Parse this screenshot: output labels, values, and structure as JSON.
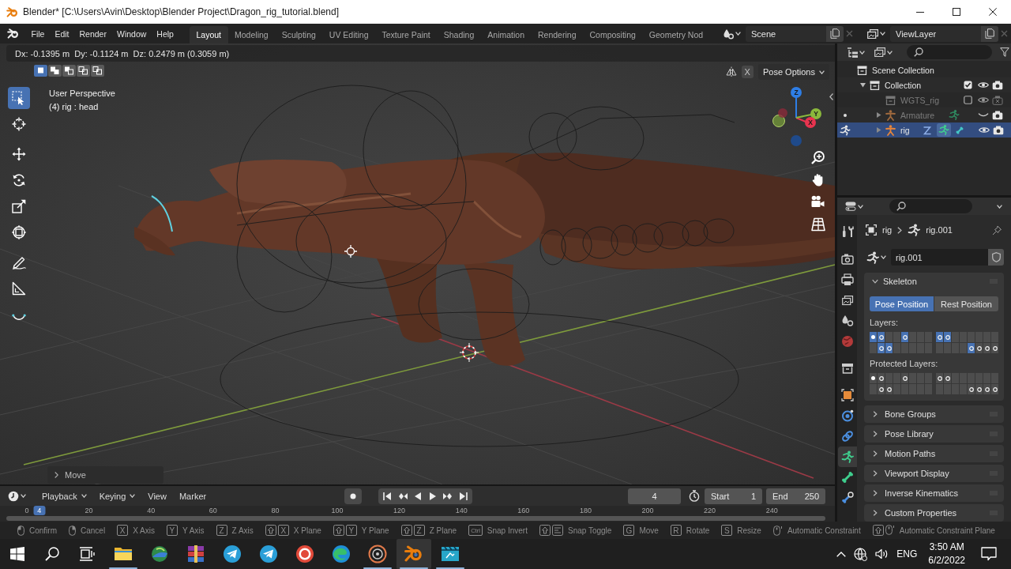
{
  "window": {
    "title": "Blender* [C:\\Users\\Avin\\Desktop\\Blender Project\\Dragon_rig_tutorial.blend]"
  },
  "menu": [
    "File",
    "Edit",
    "Render",
    "Window",
    "Help"
  ],
  "workspaces": [
    {
      "label": "Layout",
      "selected": true
    },
    {
      "label": "Modeling",
      "selected": false
    },
    {
      "label": "Sculpting",
      "selected": false
    },
    {
      "label": "UV Editing",
      "selected": false
    },
    {
      "label": "Texture Paint",
      "selected": false
    },
    {
      "label": "Shading",
      "selected": false
    },
    {
      "label": "Animation",
      "selected": false
    },
    {
      "label": "Rendering",
      "selected": false
    },
    {
      "label": "Compositing",
      "selected": false
    },
    {
      "label": "Geometry Nod",
      "selected": false
    }
  ],
  "scene": {
    "name": "Scene"
  },
  "view_layer": {
    "name": "ViewLayer"
  },
  "viewport": {
    "readout": "Dx: -0.1395 m  Dy: -0.1124 m  Dz: 0.2479 m (0.3059 m)",
    "select_modes": [
      {
        "selected": true
      },
      {
        "selected": false
      },
      {
        "selected": false
      },
      {
        "selected": false
      },
      {
        "selected": false
      }
    ],
    "view_name": "User Perspective",
    "object_info": "(4) rig : head",
    "tools": [
      {
        "selected": true
      },
      {
        "selected": false
      },
      {
        "selected": false
      },
      {
        "selected": false
      },
      {
        "selected": false
      },
      {
        "selected": false
      },
      {
        "selected": false
      },
      {
        "selected": false
      },
      {
        "selected": false
      }
    ],
    "mirror": {
      "label": "X",
      "on": false
    },
    "pose_options": "Pose Options",
    "gizmo_axes": [
      "Z",
      "Y",
      "X"
    ],
    "last_operator": "Move"
  },
  "outliner": {
    "items": [
      {
        "label": "Scene Collection",
        "kind": "scene_collection",
        "selected": false,
        "children": [
          {
            "label": "Collection",
            "kind": "collection",
            "expanded": true,
            "selected": false,
            "enabled": true,
            "visible": true,
            "renderable": true,
            "children": [
              {
                "label": "WGTS_rig",
                "kind": "collection",
                "selected": false,
                "enabled": false,
                "visible": true,
                "renderable": false
              },
              {
                "label": "Armature",
                "kind": "armature",
                "expanded": false,
                "selected": false,
                "pose_mode": false,
                "visible": false,
                "renderable": true,
                "has_constraints": false
              },
              {
                "label": "rig",
                "kind": "armature",
                "expanded": false,
                "selected": true,
                "pose_mode": true,
                "visible": true,
                "renderable": true,
                "has_constraints": true
              }
            ]
          }
        ]
      }
    ]
  },
  "properties": {
    "tabs": [
      {
        "selected": false
      },
      {
        "selected": false
      },
      {
        "selected": false
      },
      {
        "selected": false
      },
      {
        "selected": false
      },
      {
        "selected": false
      },
      {
        "selected": false
      },
      {
        "selected": false
      },
      {
        "selected": false
      },
      {
        "selected": false
      },
      {
        "selected": true
      },
      {
        "selected": false
      },
      {
        "selected": false
      }
    ],
    "breadcrumb": [
      "rig",
      "rig.001"
    ],
    "datablock": "rig.001",
    "skeleton": {
      "title": "Skeleton",
      "expanded": true,
      "positions": [
        {
          "label": "Pose Position",
          "selected": true
        },
        {
          "label": "Rest Position",
          "selected": false
        }
      ],
      "layers_label": "Layers:",
      "layers": [
        {
          "top": [
            {
              "on": true,
              "kind": "active"
            },
            {
              "on": true,
              "kind": "used"
            },
            {
              "on": false,
              "kind": "empty"
            },
            {
              "on": false,
              "kind": "empty"
            },
            {
              "on": true,
              "kind": "used"
            },
            {
              "on": false,
              "kind": "empty"
            },
            {
              "on": false,
              "kind": "empty"
            },
            {
              "on": false,
              "kind": "empty"
            }
          ],
          "bottom": [
            {
              "on": false,
              "kind": "empty"
            },
            {
              "on": true,
              "kind": "used"
            },
            {
              "on": true,
              "kind": "used"
            },
            {
              "on": false,
              "kind": "empty"
            },
            {
              "on": false,
              "kind": "empty"
            },
            {
              "on": false,
              "kind": "empty"
            },
            {
              "on": false,
              "kind": "empty"
            },
            {
              "on": false,
              "kind": "empty"
            }
          ]
        },
        {
          "top": [
            {
              "on": true,
              "kind": "used"
            },
            {
              "on": true,
              "kind": "used"
            },
            {
              "on": false,
              "kind": "empty"
            },
            {
              "on": false,
              "kind": "empty"
            },
            {
              "on": false,
              "kind": "empty"
            },
            {
              "on": false,
              "kind": "empty"
            },
            {
              "on": false,
              "kind": "empty"
            },
            {
              "on": false,
              "kind": "empty"
            }
          ],
          "bottom": [
            {
              "on": false,
              "kind": "empty"
            },
            {
              "on": false,
              "kind": "empty"
            },
            {
              "on": false,
              "kind": "empty"
            },
            {
              "on": false,
              "kind": "empty"
            },
            {
              "on": true,
              "kind": "used"
            },
            {
              "on": false,
              "kind": "used"
            },
            {
              "on": false,
              "kind": "used"
            },
            {
              "on": false,
              "kind": "used"
            }
          ]
        }
      ],
      "protected_label": "Protected Layers:",
      "protected_layers": [
        {
          "top": [
            {
              "on": false,
              "kind": "active"
            },
            {
              "on": false,
              "kind": "used"
            },
            {
              "on": false,
              "kind": "empty"
            },
            {
              "on": false,
              "kind": "empty"
            },
            {
              "on": false,
              "kind": "used"
            },
            {
              "on": false,
              "kind": "empty"
            },
            {
              "on": false,
              "kind": "empty"
            },
            {
              "on": false,
              "kind": "empty"
            }
          ],
          "bottom": [
            {
              "on": false,
              "kind": "empty"
            },
            {
              "on": false,
              "kind": "used"
            },
            {
              "on": false,
              "kind": "used"
            },
            {
              "on": false,
              "kind": "empty"
            },
            {
              "on": false,
              "kind": "empty"
            },
            {
              "on": false,
              "kind": "empty"
            },
            {
              "on": false,
              "kind": "empty"
            },
            {
              "on": false,
              "kind": "empty"
            }
          ]
        },
        {
          "top": [
            {
              "on": false,
              "kind": "used"
            },
            {
              "on": false,
              "kind": "used"
            },
            {
              "on": false,
              "kind": "empty"
            },
            {
              "on": false,
              "kind": "empty"
            },
            {
              "on": false,
              "kind": "empty"
            },
            {
              "on": false,
              "kind": "empty"
            },
            {
              "on": false,
              "kind": "empty"
            },
            {
              "on": false,
              "kind": "empty"
            }
          ],
          "bottom": [
            {
              "on": false,
              "kind": "empty"
            },
            {
              "on": false,
              "kind": "empty"
            },
            {
              "on": false,
              "kind": "empty"
            },
            {
              "on": false,
              "kind": "empty"
            },
            {
              "on": false,
              "kind": "used"
            },
            {
              "on": false,
              "kind": "used"
            },
            {
              "on": false,
              "kind": "used"
            },
            {
              "on": false,
              "kind": "used"
            }
          ]
        }
      ]
    },
    "panels": [
      {
        "title": "Bone Groups",
        "expanded": false
      },
      {
        "title": "Pose Library",
        "expanded": false
      },
      {
        "title": "Motion Paths",
        "expanded": false
      },
      {
        "title": "Viewport Display",
        "expanded": false
      },
      {
        "title": "Inverse Kinematics",
        "expanded": false
      },
      {
        "title": "Custom Properties",
        "expanded": false
      }
    ]
  },
  "timeline": {
    "menus": [
      {
        "label": "Playback",
        "dropdown": true
      },
      {
        "label": "Keying",
        "dropdown": true
      },
      {
        "label": "View",
        "dropdown": false
      },
      {
        "label": "Marker",
        "dropdown": false
      }
    ],
    "auto_keying": false,
    "frame": "4",
    "start": {
      "label": "Start",
      "value": "1"
    },
    "end": {
      "label": "End",
      "value": "250"
    },
    "ruler": [
      "0",
      "20",
      "40",
      "60",
      "80",
      "100",
      "120",
      "140",
      "160",
      "180",
      "200",
      "220",
      "240"
    ],
    "playhead": "4"
  },
  "status_hints": [
    {
      "keys": [
        {
          "kind": "mouse_left"
        }
      ],
      "label": "Confirm"
    },
    {
      "keys": [
        {
          "kind": "mouse_right"
        }
      ],
      "label": "Cancel"
    },
    {
      "keys": [
        {
          "kind": "key",
          "text": "X"
        }
      ],
      "label": "X Axis"
    },
    {
      "keys": [
        {
          "kind": "key",
          "text": "Y"
        }
      ],
      "label": "Y Axis"
    },
    {
      "keys": [
        {
          "kind": "key",
          "text": "Z"
        }
      ],
      "label": "Z Axis"
    },
    {
      "keys": [
        {
          "kind": "shift"
        },
        {
          "kind": "key",
          "text": "X"
        }
      ],
      "label": "X Plane"
    },
    {
      "keys": [
        {
          "kind": "shift"
        },
        {
          "kind": "key",
          "text": "Y"
        }
      ],
      "label": "Y Plane"
    },
    {
      "keys": [
        {
          "kind": "shift"
        },
        {
          "kind": "key",
          "text": "Z"
        }
      ],
      "label": "Z Plane"
    },
    {
      "keys": [
        {
          "kind": "key",
          "text": "Ctrl"
        }
      ],
      "label": "Snap Invert"
    },
    {
      "keys": [
        {
          "kind": "shift"
        },
        {
          "kind": "snap"
        }
      ],
      "label": "Snap Toggle"
    },
    {
      "keys": [
        {
          "kind": "key",
          "text": "G"
        }
      ],
      "label": "Move"
    },
    {
      "keys": [
        {
          "kind": "key",
          "text": "R"
        }
      ],
      "label": "Rotate"
    },
    {
      "keys": [
        {
          "kind": "key",
          "text": "S"
        }
      ],
      "label": "Resize"
    },
    {
      "keys": [
        {
          "kind": "mouse_middle"
        }
      ],
      "label": "Automatic Constraint"
    },
    {
      "keys": [
        {
          "kind": "shift"
        },
        {
          "kind": "mouse_middle"
        }
      ],
      "label": "Automatic Constraint Plane"
    }
  ],
  "taskbar": {
    "apps": [
      {
        "running": true,
        "selected": false
      },
      {
        "running": false,
        "selected": false
      },
      {
        "running": false,
        "selected": false
      },
      {
        "running": false,
        "selected": false
      },
      {
        "running": false,
        "selected": false
      },
      {
        "running": false,
        "selected": false
      },
      {
        "running": false,
        "selected": false
      },
      {
        "running": true,
        "selected": false
      },
      {
        "running": true,
        "selected": true
      },
      {
        "running": true,
        "selected": false
      }
    ],
    "language": "ENG",
    "time": "3:50 AM",
    "date": "6/2/2022"
  }
}
